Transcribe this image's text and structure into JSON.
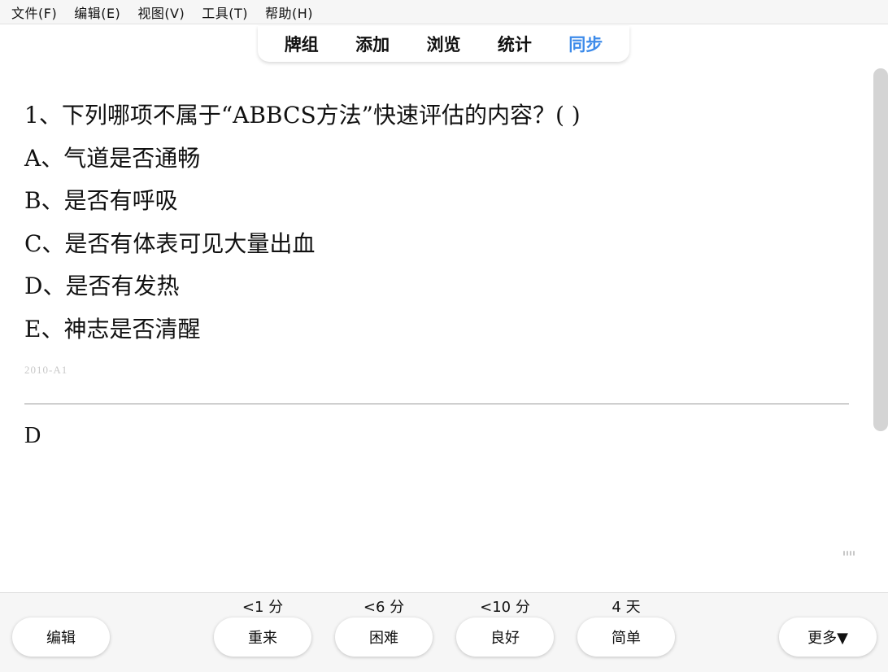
{
  "menu": {
    "items": [
      "文件(F)",
      "编辑(E)",
      "视图(V)",
      "工具(T)",
      "帮助(H)"
    ]
  },
  "nav": {
    "tabs": [
      "牌组",
      "添加",
      "浏览",
      "统计",
      "同步"
    ],
    "active_index": 4,
    "active_color": "#3d8bea"
  },
  "card": {
    "question": "1、下列哪项不属于“ABBCS方法”快速评估的内容？( )",
    "options": [
      "A、气道是否通畅",
      "B、是否有呼吸",
      "C、是否有体表可见大量出血",
      "D、是否有发热",
      "E、神志是否清醒"
    ],
    "tag": "2010-A1",
    "answer": "D"
  },
  "bottom": {
    "edit_label": "编辑",
    "more_label": "更多▼",
    "answers": [
      {
        "interval": "<1 分",
        "label": "重来"
      },
      {
        "interval": "<6 分",
        "label": "困难"
      },
      {
        "interval": "<10 分",
        "label": "良好"
      },
      {
        "interval": "4 天",
        "label": "简单"
      }
    ]
  }
}
